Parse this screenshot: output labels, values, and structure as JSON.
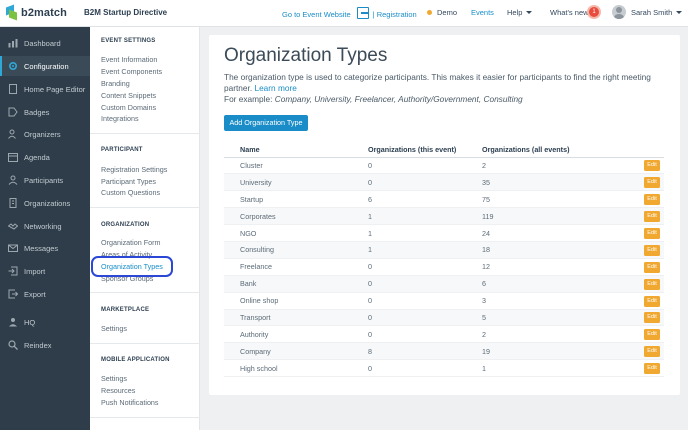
{
  "header": {
    "logo_text": "b2match",
    "directive": "B2M Startup Directive",
    "goto_text": "Go to Event Website",
    "registration": "| Registration",
    "demo": "Demo",
    "events": "Events",
    "help": "Help",
    "whats_new": "What's new",
    "whats_new_count": "1",
    "user": "Sarah Smith",
    "accent_color": "#1a8dc9",
    "demo_dot_color": "#f0a830"
  },
  "leftnav": {
    "items": [
      {
        "label": "Dashboard",
        "icon": "dashboard-icon"
      },
      {
        "label": "Configuration",
        "icon": "gear-icon"
      },
      {
        "label": "Home Page Editor",
        "icon": "page-icon"
      },
      {
        "label": "Badges",
        "icon": "badge-icon"
      },
      {
        "label": "Organizers",
        "icon": "users-icon"
      },
      {
        "label": "Agenda",
        "icon": "calendar-icon"
      },
      {
        "label": "Participants",
        "icon": "person-icon"
      },
      {
        "label": "Organizations",
        "icon": "building-icon"
      },
      {
        "label": "Networking",
        "icon": "handshake-icon"
      },
      {
        "label": "Messages",
        "icon": "mail-icon"
      },
      {
        "label": "Import",
        "icon": "import-icon"
      },
      {
        "label": "Export",
        "icon": "export-icon"
      },
      {
        "label": "HQ",
        "icon": "hq-icon"
      },
      {
        "label": "Reindex",
        "icon": "search-icon"
      }
    ]
  },
  "settings": {
    "event_settings": {
      "title": "EVENT SETTINGS",
      "items": [
        "Event Information",
        "Event Components",
        "Branding",
        "Content Snippets",
        "Custom Domains",
        "Integrations"
      ]
    },
    "participant": {
      "title": "PARTICIPANT",
      "items": [
        "Registration Settings",
        "Participant Types",
        "Custom Questions"
      ]
    },
    "organization": {
      "title": "ORGANIZATION",
      "items": [
        "Organization Form",
        "Areas of Activity",
        "Organization Types",
        "Sponsor Groups"
      ]
    },
    "marketplace": {
      "title": "MARKETPLACE",
      "items": [
        "Settings"
      ]
    },
    "mobile": {
      "title": "MOBILE APPLICATION",
      "items": [
        "Settings",
        "Resources",
        "Push Notifications"
      ]
    }
  },
  "main": {
    "title": "Organization Types",
    "description": "The organization type is used to categorize participants. This makes it easier for participants to find the right meeting partner.",
    "learn_more": "Learn more",
    "example_prefix": "For example:",
    "example_list": "Company, University, Freelancer, Authority/Government, Consulting",
    "add_button": "Add Organization Type",
    "columns": [
      "Name",
      "Organizations (this event)",
      "Organizations (all events)",
      ""
    ],
    "edit_label": "Edit",
    "edit_color": "#f0a830",
    "rows": [
      {
        "name": "Cluster",
        "this_event": "0",
        "all_events": "2"
      },
      {
        "name": "University",
        "this_event": "0",
        "all_events": "35"
      },
      {
        "name": "Startup",
        "this_event": "6",
        "all_events": "75"
      },
      {
        "name": "Corporates",
        "this_event": "1",
        "all_events": "119"
      },
      {
        "name": "NGO",
        "this_event": "1",
        "all_events": "24"
      },
      {
        "name": "Consulting",
        "this_event": "1",
        "all_events": "18"
      },
      {
        "name": "Freelance",
        "this_event": "0",
        "all_events": "12"
      },
      {
        "name": "Bank",
        "this_event": "0",
        "all_events": "6"
      },
      {
        "name": "Online shop",
        "this_event": "0",
        "all_events": "3"
      },
      {
        "name": "Transport",
        "this_event": "0",
        "all_events": "5"
      },
      {
        "name": "Authority",
        "this_event": "0",
        "all_events": "2"
      },
      {
        "name": "Company",
        "this_event": "8",
        "all_events": "19"
      },
      {
        "name": "High school",
        "this_event": "0",
        "all_events": "1"
      }
    ]
  }
}
